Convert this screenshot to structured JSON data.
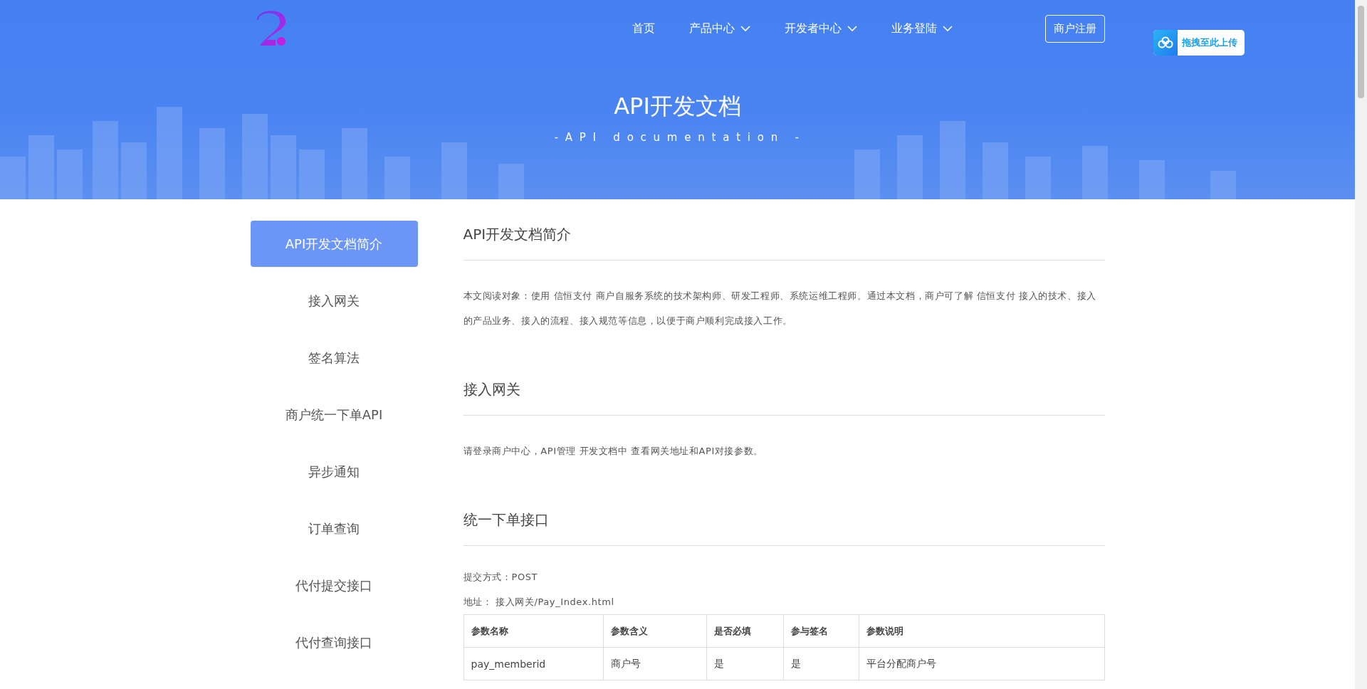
{
  "nav": {
    "items": [
      {
        "label": "首页",
        "dropdown": false
      },
      {
        "label": "产品中心",
        "dropdown": true
      },
      {
        "label": "开发者中心",
        "dropdown": true
      },
      {
        "label": "业务登陆",
        "dropdown": true
      }
    ],
    "register_button": "商户注册"
  },
  "upload_widget": {
    "label": "拖拽至此上传"
  },
  "banner": {
    "title": "API开发文档",
    "subtitle": "- A P I   d o c u m e n t a t i o n   -"
  },
  "sidebar": {
    "items": [
      {
        "label": "API开发文档简介",
        "selected": true
      },
      {
        "label": "接入网关",
        "selected": false
      },
      {
        "label": "签名算法",
        "selected": false
      },
      {
        "label": "商户统一下单API",
        "selected": false
      },
      {
        "label": "异步通知",
        "selected": false
      },
      {
        "label": "订单查询",
        "selected": false
      },
      {
        "label": "代付提交接口",
        "selected": false
      },
      {
        "label": "代付查询接口",
        "selected": false
      }
    ]
  },
  "sections": [
    {
      "heading": "API开发文档简介",
      "paragraphs": [
        "本文阅读对象：使用 信恒支付 商户自服务系统的技术架构师、研发工程师、系统运维工程师。通过本文档，商户可了解 信恒支付 接入的技术、接入的产品业务、接入的流程、接入规范等信息，以便于商户顺利完成接入工作。"
      ]
    },
    {
      "heading": "接入网关",
      "paragraphs": [
        "请登录商户中心，API管理 开发文档中 查看网关地址和API对接参数。"
      ]
    },
    {
      "heading": "统一下单接口",
      "paragraphs": [
        "提交方式：POST",
        "地址： 接入网关/Pay_Index.html"
      ],
      "table": {
        "columns": [
          "参数名称",
          "参数含义",
          "是否必填",
          "参与签名",
          "参数说明"
        ],
        "rows": [
          [
            "pay_memberid",
            "商户号",
            "是",
            "是",
            "平台分配商户号"
          ]
        ]
      }
    }
  ]
}
